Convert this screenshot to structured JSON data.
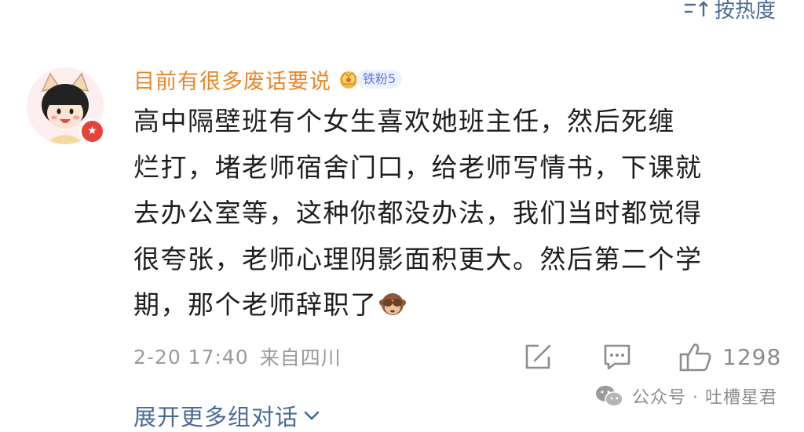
{
  "sort": {
    "label": "按热度",
    "icon": "sort-icon"
  },
  "comment": {
    "avatar_icon": "avatar-icon",
    "username": "目前有很多废话要说",
    "fan_badge": {
      "icon": "crown-icon",
      "label": "铁粉5"
    },
    "lines": [
      "高中隔壁班有个女生喜欢她班主任，然后死缠",
      "烂打，堵老师宿舍门口，给老师写情书，下课就",
      "去办公室等，这种你都没办法，我们当时都觉得",
      "很夸张，老师心理阴影面积更大。然后第二个学",
      "期，那个老师辞职了"
    ],
    "emoji": "see-no-evil-monkey-emoji",
    "timestamp": "2-20 17:40",
    "source": "来自四川",
    "actions": {
      "share_icon": "share-icon",
      "reply_icon": "comment-icon",
      "like_icon": "thumbs-up-icon",
      "like_count": "1298"
    }
  },
  "watermark": {
    "icon": "wechat-icon",
    "text": "公众号 · 吐槽星君"
  },
  "expand": {
    "label": "展开更多组对话",
    "icon": "chevron-down-icon"
  },
  "colors": {
    "link": "#4a6a96",
    "username": "#e8872b",
    "meta": "#9a9a9a",
    "badge_bg": "#eef1ff",
    "badge_text": "#5e7be0"
  }
}
